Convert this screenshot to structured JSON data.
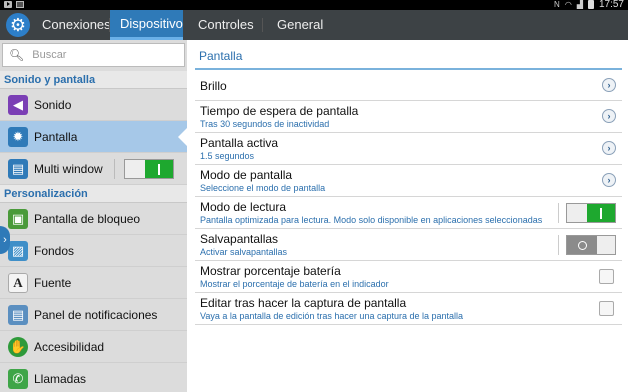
{
  "status_bar": {
    "time": "17:57",
    "icons": [
      "youtube-icon",
      "image-icon",
      "nfc-icon",
      "wifi-icon",
      "signal-icon",
      "battery-icon"
    ]
  },
  "action_bar": {
    "app_icon": "gear-icon",
    "tabs": [
      {
        "label": "Conexiones",
        "active": false
      },
      {
        "label": "Dispositivo",
        "active": true
      },
      {
        "label": "Controles",
        "active": false
      },
      {
        "label": "General",
        "active": false
      }
    ]
  },
  "sidebar": {
    "search_placeholder": "Buscar",
    "sections": [
      {
        "header": "Sonido y pantalla"
      },
      {
        "header": "Personalización"
      }
    ],
    "items": [
      {
        "label": "Sonido",
        "icon": "speaker-icon"
      },
      {
        "label": "Pantalla",
        "icon": "brightness-icon",
        "selected": true
      },
      {
        "label": "Multi window",
        "icon": "multi-window-icon",
        "toggle": "on"
      },
      {
        "label": "Pantalla de bloqueo",
        "icon": "lock-screen-icon"
      },
      {
        "label": "Fondos",
        "icon": "wallpaper-icon"
      },
      {
        "label": "Fuente",
        "icon": "font-icon"
      },
      {
        "label": "Panel de notificaciones",
        "icon": "notification-panel-icon"
      },
      {
        "label": "Accesibilidad",
        "icon": "accessibility-icon"
      },
      {
        "label": "Llamadas",
        "icon": "call-icon"
      }
    ]
  },
  "content": {
    "title": "Pantalla",
    "rows": [
      {
        "title": "Brillo",
        "subtitle": "",
        "control": "chevron"
      },
      {
        "title": "Tiempo de espera de pantalla",
        "subtitle": "Tras 30 segundos de inactividad",
        "control": "chevron"
      },
      {
        "title": "Pantalla activa",
        "subtitle": "1.5 segundos",
        "control": "chevron"
      },
      {
        "title": "Modo de pantalla",
        "subtitle": "Seleccione el modo de pantalla",
        "control": "chevron"
      },
      {
        "title": "Modo de lectura",
        "subtitle": "Pantalla optimizada para lectura. Modo solo disponible en aplicaciones seleccionadas",
        "control": "switch-on"
      },
      {
        "title": "Salvapantallas",
        "subtitle": "Activar salvapantallas",
        "control": "switch-off"
      },
      {
        "title": "Mostrar porcentaje batería",
        "subtitle": "Mostrar el porcentaje de batería en el indicador",
        "control": "checkbox",
        "checked": false
      },
      {
        "title": "Editar tras hacer la captura de pantalla",
        "subtitle": "Vaya a la pantalla de edición tras hacer una captura de la pantalla",
        "control": "checkbox",
        "checked": false
      }
    ]
  },
  "colors": {
    "accent": "#2f7ab8",
    "toggle_on": "#1ea82f",
    "section_text": "#2b6fad",
    "action_bar": "#3d4245"
  }
}
